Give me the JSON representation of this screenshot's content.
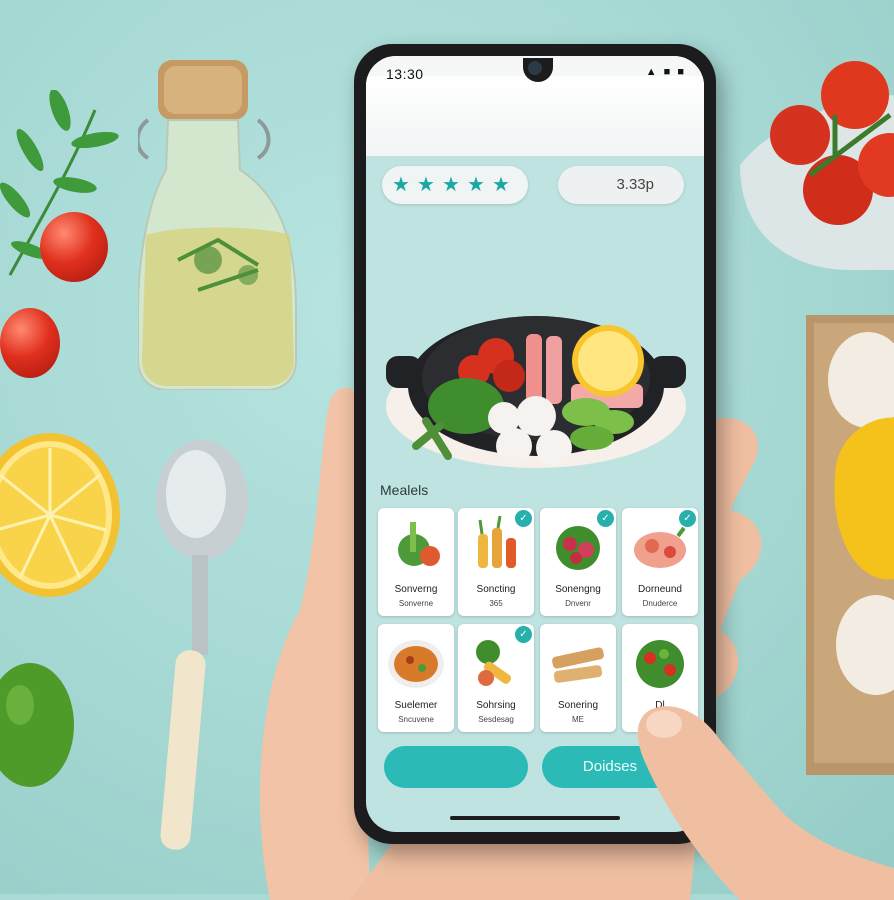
{
  "status_bar": {
    "time": "13:30",
    "icons": "▲ ■ ■"
  },
  "rating": {
    "stars": 5,
    "star_color": "#1aa8a4"
  },
  "count": "3.33p",
  "section_title": "Mealels",
  "meal_cards": [
    {
      "title": "Sonverng",
      "subtitle": "Sonverne",
      "badge": false
    },
    {
      "title": "Soncting",
      "subtitle": "365",
      "badge": true
    },
    {
      "title": "Sonengng",
      "subtitle": "Dnvenr",
      "badge": true
    },
    {
      "title": "Dorneund",
      "subtitle": "Dnuderce",
      "badge": true
    },
    {
      "title": "Suelemer",
      "subtitle": "Sncuvene",
      "badge": false
    },
    {
      "title": "Sohrsing",
      "subtitle": "Sesdesag",
      "badge": true
    },
    {
      "title": "Sonering",
      "subtitle": "ME",
      "badge": false
    },
    {
      "title": "Dl",
      "subtitle": "",
      "badge": false
    }
  ],
  "buttons": {
    "primary": "",
    "secondary": "Doidses"
  },
  "colors": {
    "accent": "#2cbab6",
    "background": "#a9dad6"
  }
}
